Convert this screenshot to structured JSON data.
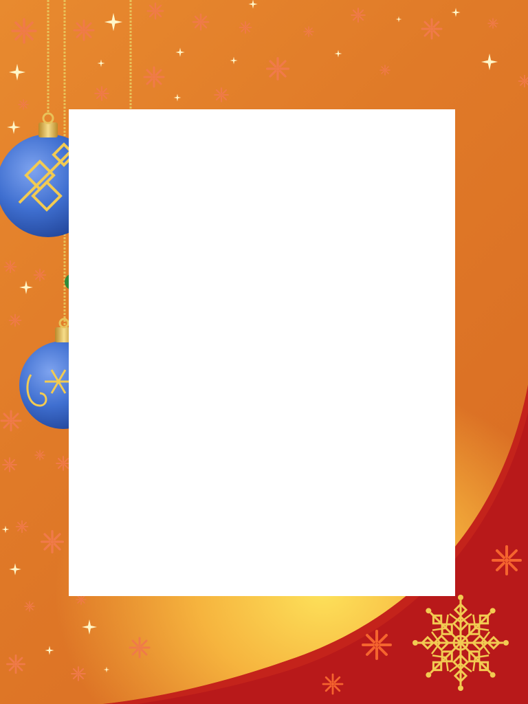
{
  "scene": {
    "colors": {
      "background_orange": "#e07a28",
      "glow_yellow": "#fde15a",
      "red_swoosh": "#b8191a",
      "ornament_blue": "#3f6fd0",
      "ornament_gold": "#e8c25a",
      "frame_white": "#ffffff"
    },
    "decorations": [
      "hanging-chain",
      "blue-ornament-snowflake",
      "blue-ornament-swirl",
      "gold-snowflake",
      "sparkle-star",
      "orange-flower-snowflake"
    ]
  }
}
